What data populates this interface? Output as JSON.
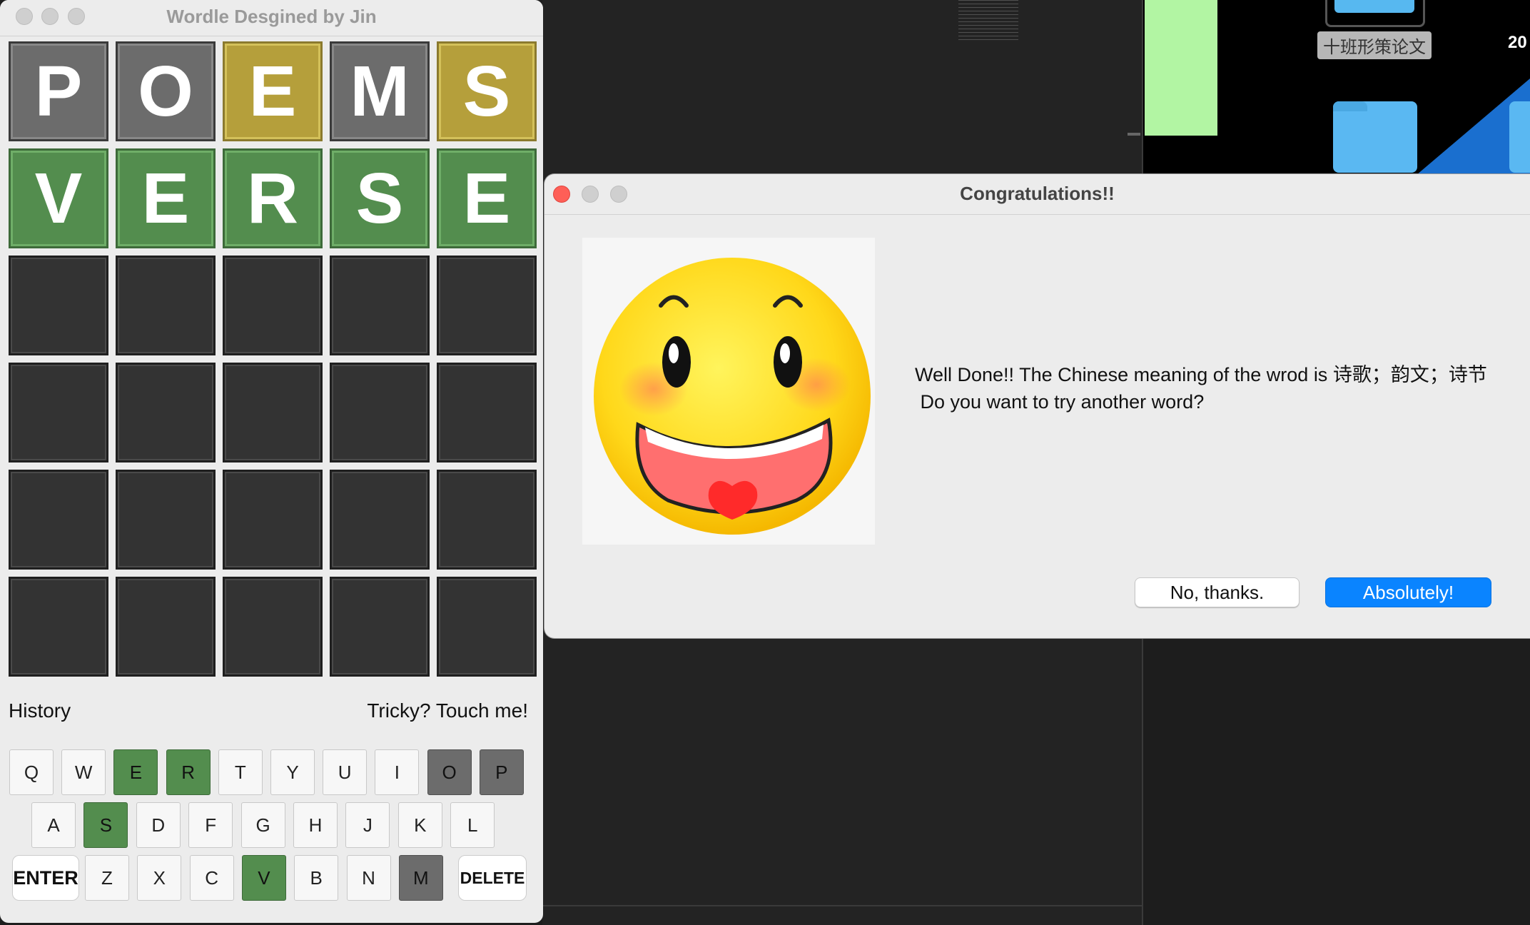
{
  "wordle": {
    "title": "Wordle Desgined by Jin",
    "rows": [
      [
        {
          "letter": "P",
          "state": "gray"
        },
        {
          "letter": "O",
          "state": "gray"
        },
        {
          "letter": "E",
          "state": "yellow"
        },
        {
          "letter": "M",
          "state": "gray"
        },
        {
          "letter": "S",
          "state": "yellow"
        }
      ],
      [
        {
          "letter": "V",
          "state": "green"
        },
        {
          "letter": "E",
          "state": "green"
        },
        {
          "letter": "R",
          "state": "green"
        },
        {
          "letter": "S",
          "state": "green"
        },
        {
          "letter": "E",
          "state": "green"
        }
      ],
      [
        {
          "letter": "",
          "state": "empty"
        },
        {
          "letter": "",
          "state": "empty"
        },
        {
          "letter": "",
          "state": "empty"
        },
        {
          "letter": "",
          "state": "empty"
        },
        {
          "letter": "",
          "state": "empty"
        }
      ],
      [
        {
          "letter": "",
          "state": "empty"
        },
        {
          "letter": "",
          "state": "empty"
        },
        {
          "letter": "",
          "state": "empty"
        },
        {
          "letter": "",
          "state": "empty"
        },
        {
          "letter": "",
          "state": "empty"
        }
      ],
      [
        {
          "letter": "",
          "state": "empty"
        },
        {
          "letter": "",
          "state": "empty"
        },
        {
          "letter": "",
          "state": "empty"
        },
        {
          "letter": "",
          "state": "empty"
        },
        {
          "letter": "",
          "state": "empty"
        }
      ],
      [
        {
          "letter": "",
          "state": "empty"
        },
        {
          "letter": "",
          "state": "empty"
        },
        {
          "letter": "",
          "state": "empty"
        },
        {
          "letter": "",
          "state": "empty"
        },
        {
          "letter": "",
          "state": "empty"
        }
      ]
    ],
    "history_label": "History",
    "hint_label": "Tricky? Touch me!",
    "keyboard": [
      [
        {
          "label": "Q",
          "state": "none"
        },
        {
          "label": "W",
          "state": "none"
        },
        {
          "label": "E",
          "state": "green"
        },
        {
          "label": "R",
          "state": "green"
        },
        {
          "label": "T",
          "state": "none"
        },
        {
          "label": "Y",
          "state": "none"
        },
        {
          "label": "U",
          "state": "none"
        },
        {
          "label": "I",
          "state": "none"
        },
        {
          "label": "O",
          "state": "dark"
        },
        {
          "label": "P",
          "state": "dark"
        }
      ],
      [
        {
          "label": "A",
          "state": "none"
        },
        {
          "label": "S",
          "state": "green"
        },
        {
          "label": "D",
          "state": "none"
        },
        {
          "label": "F",
          "state": "none"
        },
        {
          "label": "G",
          "state": "none"
        },
        {
          "label": "H",
          "state": "none"
        },
        {
          "label": "J",
          "state": "none"
        },
        {
          "label": "K",
          "state": "none"
        },
        {
          "label": "L",
          "state": "none"
        }
      ],
      [
        {
          "label": "ENTER",
          "state": "big"
        },
        {
          "label": "Z",
          "state": "none"
        },
        {
          "label": "X",
          "state": "none"
        },
        {
          "label": "C",
          "state": "none"
        },
        {
          "label": "V",
          "state": "green"
        },
        {
          "label": "B",
          "state": "none"
        },
        {
          "label": "N",
          "state": "none"
        },
        {
          "label": "M",
          "state": "dark"
        },
        {
          "label": "DELETE",
          "state": "big"
        }
      ]
    ]
  },
  "dialog": {
    "title": "Congratulations!!",
    "message_line1": "Well Done!! The Chinese meaning of the wrod is 诗歌；韵文；诗节",
    "message_line2": " Do you want to try another word?",
    "no_label": "No, thanks.",
    "yes_label": "Absolutely!",
    "image": "smiley-face"
  },
  "desktop": {
    "folder_label": "十班形策论文",
    "number_fragment": "20"
  },
  "colors": {
    "gray": "#6c6c6c",
    "yellow": "#b59f3b",
    "green": "#538d4e",
    "primary_button": "#0a84ff",
    "close_red": "#fe5f57"
  }
}
